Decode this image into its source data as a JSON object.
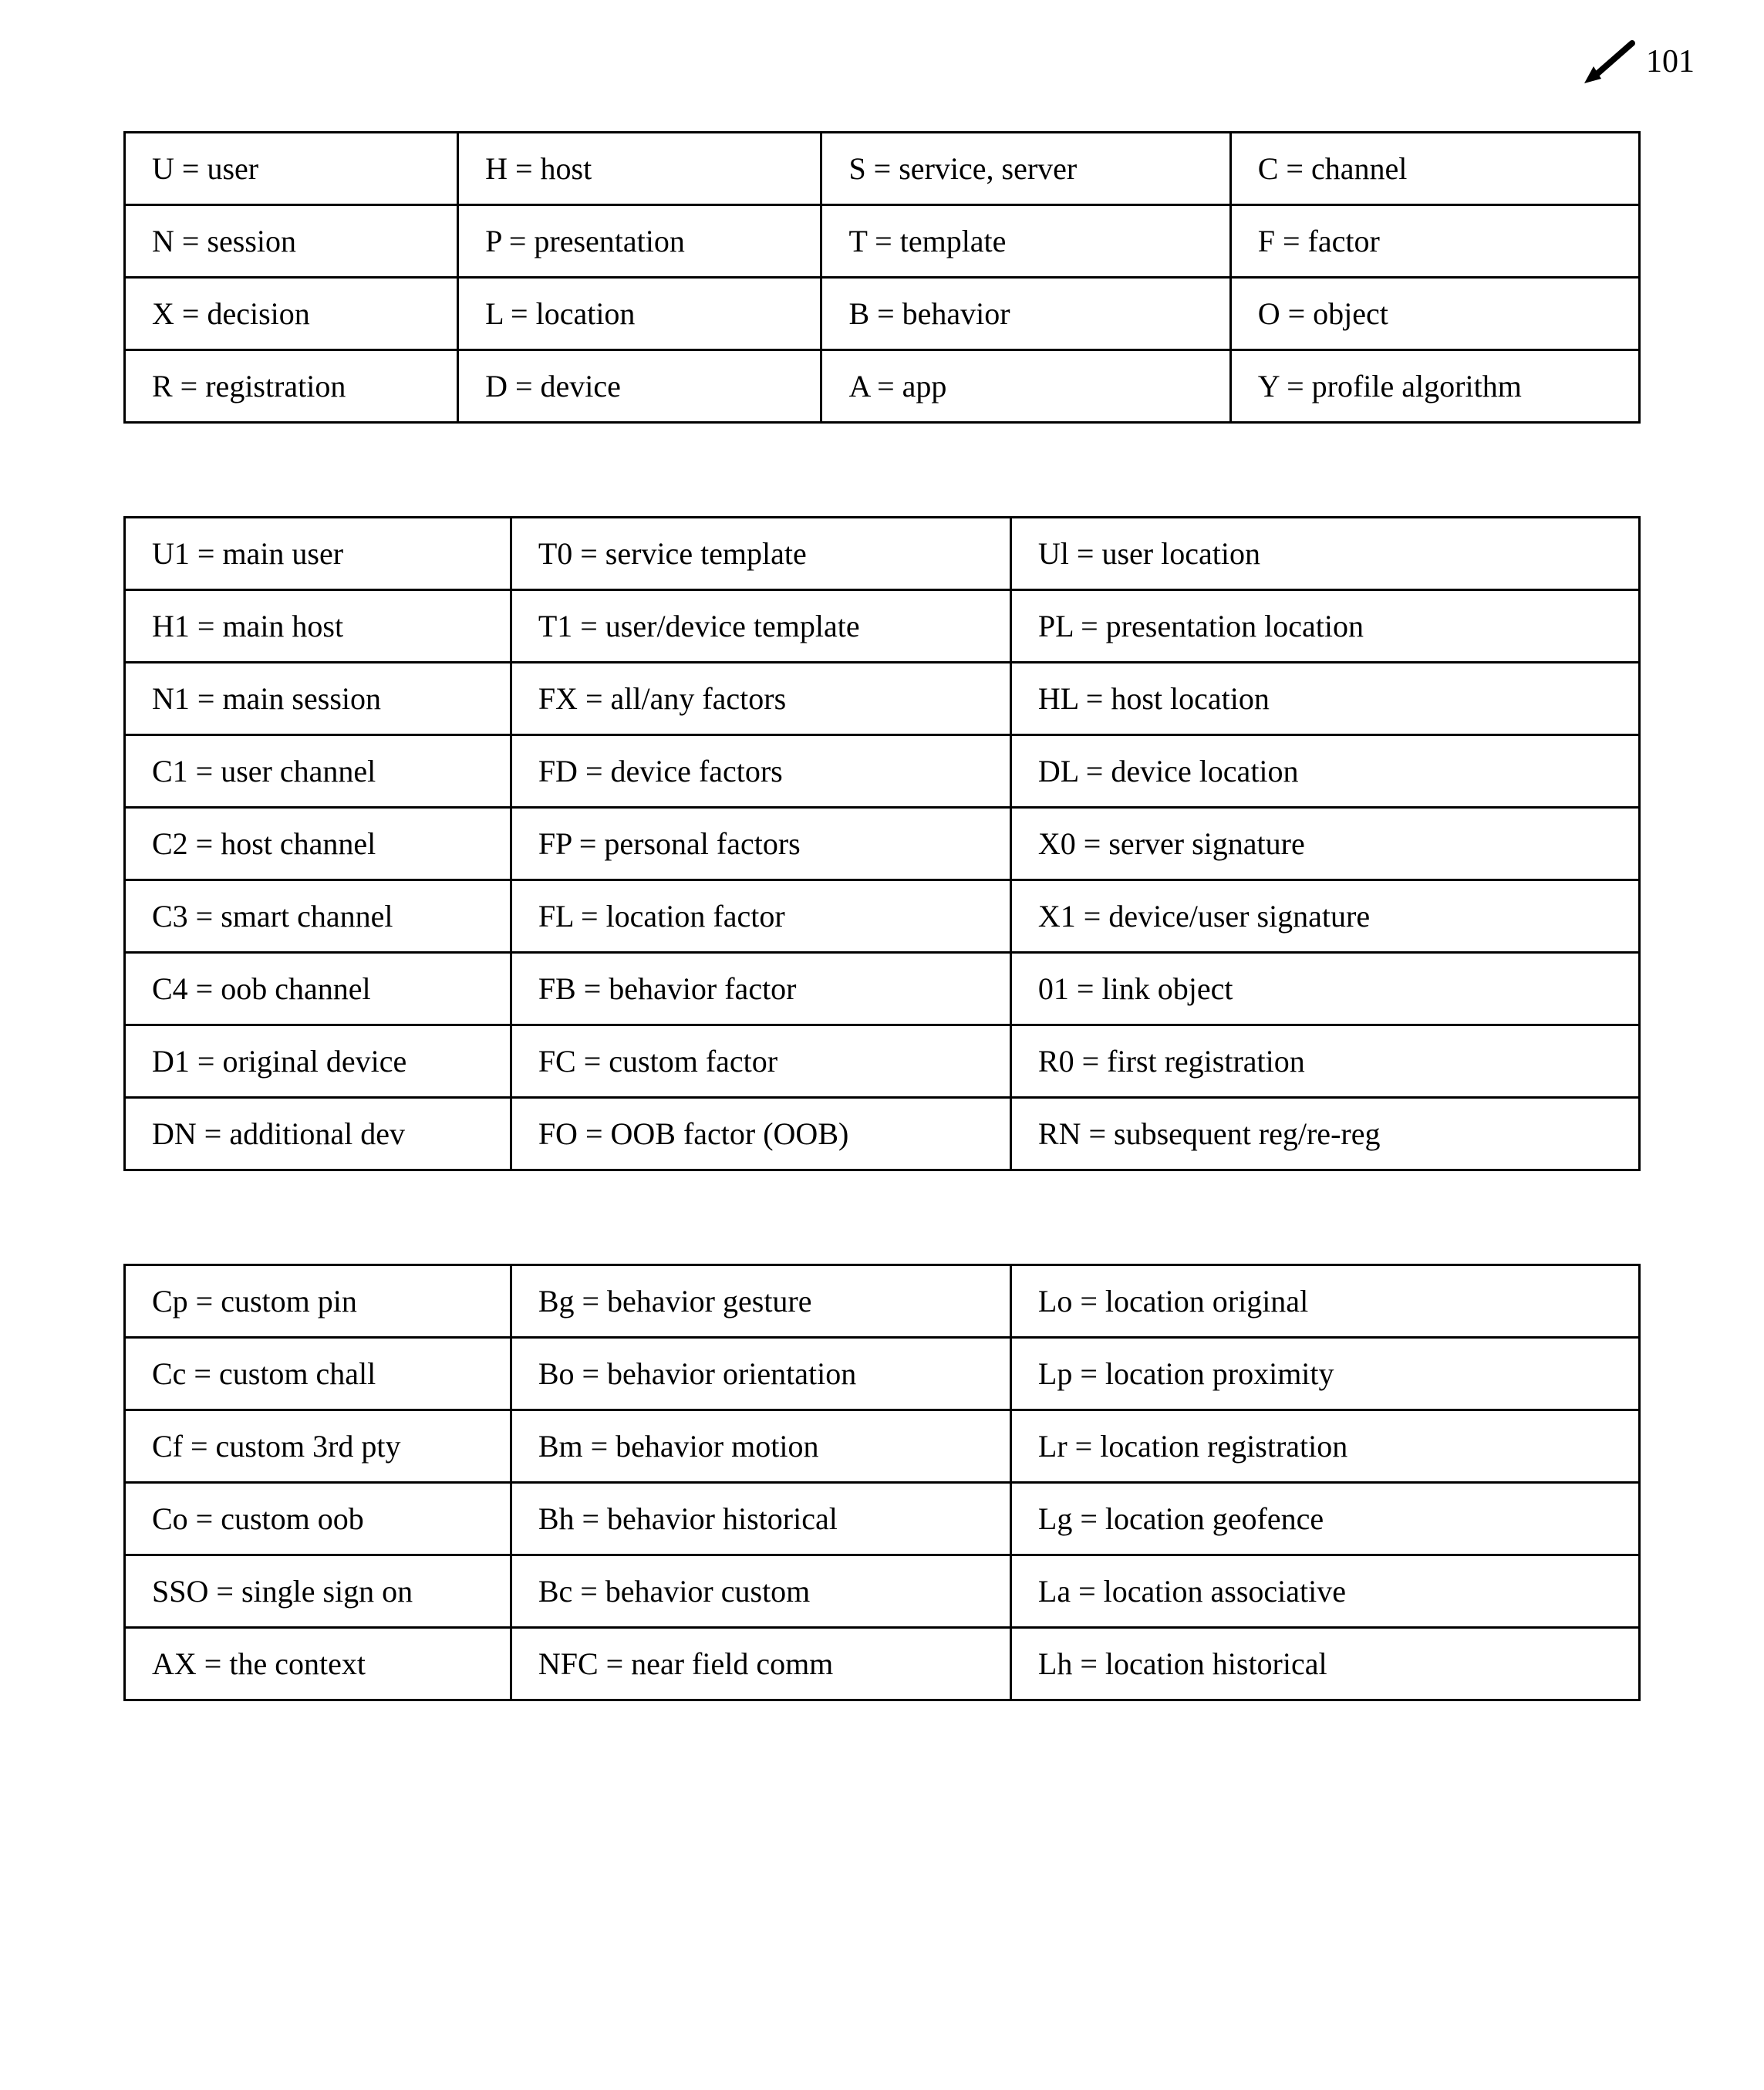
{
  "ref_number": "101",
  "table1": [
    [
      "U = user",
      "H = host",
      "S = service, server",
      "C = channel"
    ],
    [
      "N = session",
      "P = presentation",
      "T = template",
      "F = factor"
    ],
    [
      "X = decision",
      "L = location",
      "B = behavior",
      "O = object"
    ],
    [
      "R = registration",
      "D = device",
      "A = app",
      "Y = profile algorithm"
    ]
  ],
  "table2": [
    [
      "U1 = main user",
      "T0 = service template",
      "Ul =  user location"
    ],
    [
      "H1 = main host",
      "T1 = user/device template",
      "PL = presentation location"
    ],
    [
      "N1 = main session",
      "FX = all/any factors",
      "HL = host location"
    ],
    [
      "C1 = user channel",
      "FD = device factors",
      "DL = device location"
    ],
    [
      "C2 = host channel",
      "FP = personal factors",
      "X0 = server signature"
    ],
    [
      "C3 = smart channel",
      "FL = location factor",
      "X1 = device/user signature"
    ],
    [
      "C4 = oob channel",
      "FB = behavior factor",
      "01 = link object"
    ],
    [
      "D1 = original device",
      "FC = custom factor",
      "R0 = first registration"
    ],
    [
      "DN = additional dev",
      "FO = OOB factor (OOB)",
      "RN = subsequent reg/re-reg"
    ]
  ],
  "table3": [
    [
      "Cp = custom pin",
      "Bg = behavior gesture",
      "Lo = location original"
    ],
    [
      "Cc = custom chall",
      "Bo = behavior orientation",
      "Lp = location proximity"
    ],
    [
      "Cf = custom 3rd pty",
      "Bm = behavior motion",
      "Lr = location registration"
    ],
    [
      "Co = custom oob",
      "Bh = behavior historical",
      "Lg = location geofence"
    ],
    [
      "SSO = single sign on",
      "Bc = behavior custom",
      "La = location associative"
    ],
    [
      "AX = the context",
      "NFC = near field comm",
      "Lh = location historical"
    ]
  ]
}
